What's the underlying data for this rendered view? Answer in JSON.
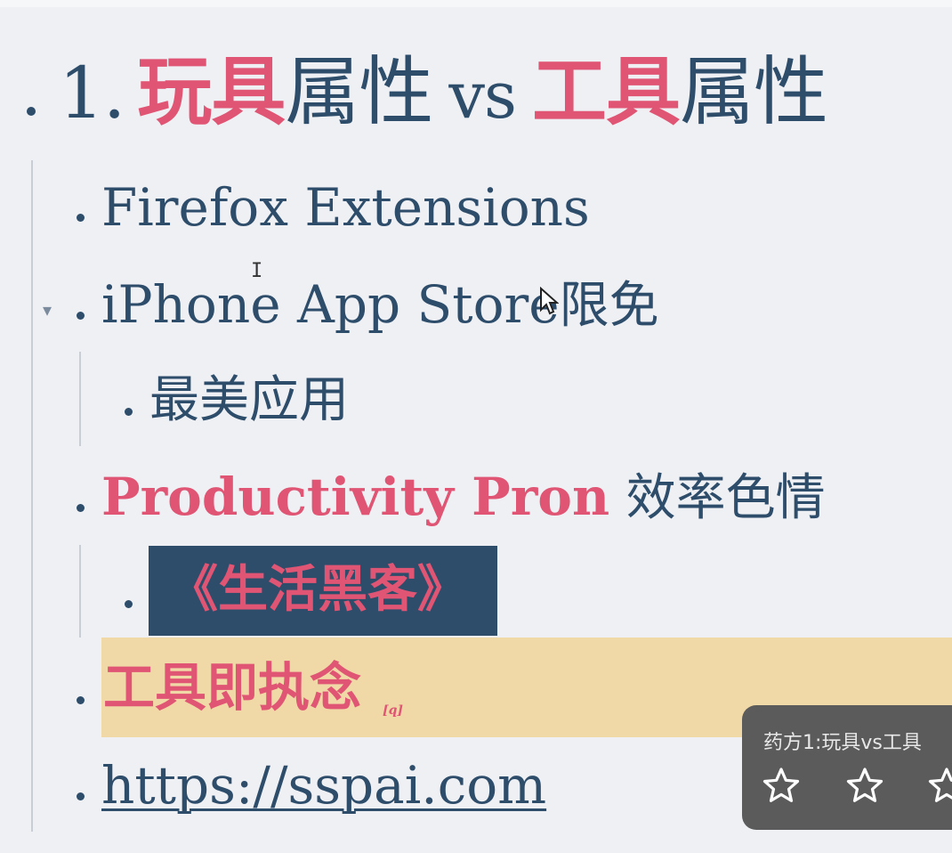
{
  "outline": {
    "title": {
      "number": "1.",
      "toy": "玩具",
      "attr1": "属性",
      "vs": "vs",
      "tool": "工具",
      "attr2": "属性"
    },
    "items": {
      "firefox": "Firefox Extensions",
      "iphone_prefix": "iPhone App Store",
      "iphone_suffix": "限免",
      "best_apps": "最美应用",
      "productivity_en": "Productivity Pron",
      "productivity_cn": "效率色情",
      "lifehacker": "《生活黑客》",
      "tool_obsession": "工具即执念",
      "note_mark": "[q]",
      "link": "https://sspai.com"
    }
  },
  "toast": {
    "title": "药方1:玩具vs工具",
    "rating": "0 of 5 stars",
    "stars": [
      "star-outline",
      "star-outline",
      "star-outline"
    ]
  },
  "colors": {
    "accent_red": "#e05574",
    "text_blue": "#2e4d6b",
    "highlight_yellow": "#f1d9a7",
    "background": "#eef0f4"
  }
}
